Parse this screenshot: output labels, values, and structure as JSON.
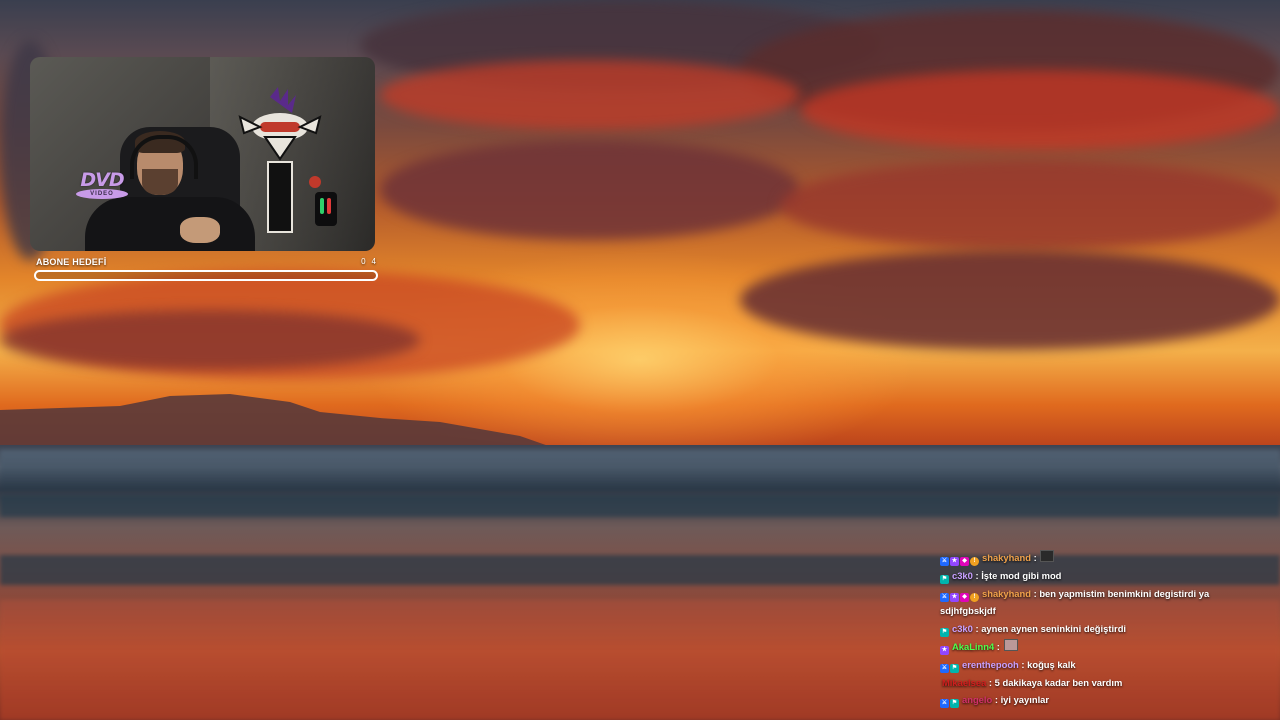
{
  "scene": {
    "description_hidden": true
  },
  "webcam": {
    "overlay_logo_text": "DVD",
    "overlay_logo_subtext": "VIDEO"
  },
  "goal": {
    "label": "ABONE HEDEFİ",
    "current": "0",
    "target": "4",
    "progress_fraction": 0
  },
  "chat": {
    "messages": [
      {
        "user": "shakyhand",
        "user_color": "#f0a14a",
        "badges": [
          "mod",
          "sub",
          "vip",
          "gift"
        ],
        "text": "",
        "emote": "dark"
      },
      {
        "user": "c3k0",
        "user_color": "#c8a0ff",
        "badges": [
          "tier"
        ],
        "text": "İşte mod gibi mod",
        "emote": ""
      },
      {
        "user": "shakyhand",
        "user_color": "#f0a14a",
        "badges": [
          "mod",
          "sub",
          "vip",
          "gift"
        ],
        "text": "ben yapmistim benimkini degistirdi ya sdjhfgbskjdf",
        "emote": ""
      },
      {
        "user": "c3k0",
        "user_color": "#c8a0ff",
        "badges": [
          "tier"
        ],
        "text": "aynen aynen seninkini değiştirdi",
        "emote": ""
      },
      {
        "user": "AkaLinn4",
        "user_color": "#4cff4c",
        "badges": [
          "sub"
        ],
        "text": "",
        "emote": "pink"
      },
      {
        "user": "erenthepooh",
        "user_color": "#c8a0ff",
        "badges": [
          "mod",
          "tier"
        ],
        "text": "koğuş kalk",
        "emote": ""
      },
      {
        "user": "Mikaelsea",
        "user_color": "#d01e1e",
        "badges": [],
        "text": "5 dakikaya kadar ben vardım",
        "emote": ""
      },
      {
        "user": "angelo",
        "user_color": "#d0306a",
        "badges": [
          "mod",
          "tier"
        ],
        "text": "iyi yayınlar",
        "emote": ""
      }
    ]
  }
}
